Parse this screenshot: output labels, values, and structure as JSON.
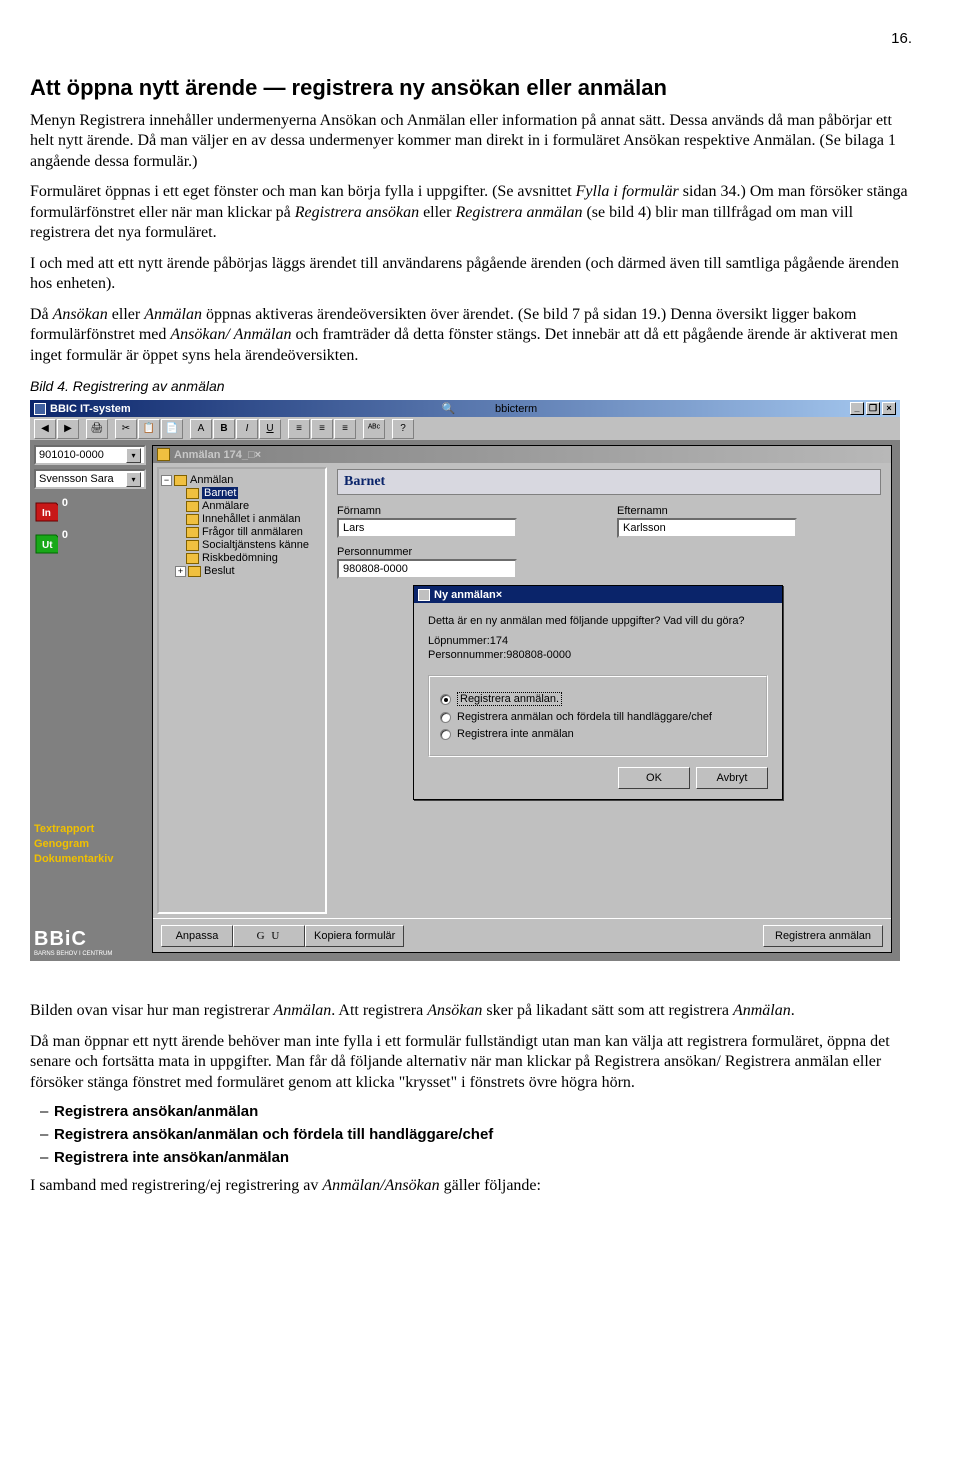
{
  "page_number": "16.",
  "heading": "Att öppna nytt ärende — registrera ny ansökan eller anmälan",
  "para1": "Menyn Registrera innehåller undermenyerna Ansökan och Anmälan eller information på annat sätt. Dessa används då man påbörjar ett helt nytt ärende. Då man väljer en av dessa undermenyer kommer man direkt in i formuläret Ansökan respektive Anmälan. (Se bilaga 1 angående dessa formulär.)",
  "para2a": "Formuläret öppnas i ett eget fönster och man kan börja fylla i uppgifter. (Se avsnittet ",
  "para2b": "Fylla i formulär",
  "para2c": " sidan 34.) Om man försöker stänga formulärfönstret eller när man klickar på ",
  "para2d": "Registrera ansökan",
  "para2e": " eller ",
  "para2f": "Registrera anmälan",
  "para2g": " (se bild 4) blir man tillfrågad om man vill registrera det nya formuläret.",
  "para3": "I och med att ett nytt ärende påbörjas läggs ärendet till användarens pågående ärenden (och därmed även till samtliga pågående ärenden hos enheten).",
  "para4a": "Då ",
  "para4b": "Ansökan",
  "para4c": " eller ",
  "para4d": "Anmälan",
  "para4e": " öppnas aktiveras ärendeöversikten över ärendet. (Se bild 7 på sidan 19.) Denna översikt ligger bakom formulärfönstret med ",
  "para4f": "Ansökan/ Anmälan",
  "para4g": " och framträder då detta fönster stängs. Det innebär att då ett pågående ärende är aktiverat men inget formulär är öppet syns hela ärendeöversikten.",
  "caption": "Bild 4.  Registrering av anmälan",
  "shot": {
    "main_title": "BBIC IT-system",
    "term": "bbicterm",
    "search_icon": "🔍",
    "toolbar": [
      "◀",
      "▶",
      "|",
      "🖨",
      "|",
      "✂",
      "📋",
      "📄",
      "|",
      "A",
      "B",
      "I",
      "U",
      "|",
      "≡",
      "≡",
      "≡",
      "|",
      "ᴬᴮᶜ",
      "|",
      "?"
    ],
    "combo1": "901010-0000",
    "combo2": "Svensson Sara",
    "in_count": "0",
    "out_count": "0",
    "links": [
      "Textrapport",
      "Genogram",
      "Dokumentarkiv"
    ],
    "logo": "BBiC",
    "logo_sub": "BARNS BEHOV I CENTRUM",
    "child_title": "Anmälan 174",
    "tree": {
      "root": "Anmälan",
      "items": [
        "Barnet",
        "Anmälare",
        "Innehållet i anmälan",
        "Frågor till anmälaren",
        "Socialtjänstens känne",
        "Riskbedömning",
        "Beslut"
      ]
    },
    "form_header": "Barnet",
    "field_fn_label": "Förnamn",
    "field_fn_value": "Lars",
    "field_ln_label": "Efternamn",
    "field_ln_value": "Karlsson",
    "field_pn_label": "Personnummer",
    "field_pn_value": "980808-0000",
    "dialog": {
      "title": "Ny anmälan",
      "question": "Detta är en ny anmälan med följande uppgifter? Vad vill du göra?",
      "info1": "Löpnummer:174",
      "info2": "Personnummer:980808-0000",
      "opts": [
        "Registrera anmälan.",
        "Registrera anmälan och fördela till handläggare/chef",
        "Registrera inte anmälan"
      ],
      "ok": "OK",
      "cancel": "Avbryt"
    },
    "bottom": {
      "anpassa": "Anpassa",
      "gu": "G U",
      "kopiera": "Kopiera formulär",
      "registrera": "Registrera anmälan"
    }
  },
  "after1a": "Bilden ovan visar hur man registrerar ",
  "after1b": "Anmälan",
  "after1c": ". Att registrera ",
  "after1d": "Ansökan",
  "after1e": " sker på likadant sätt som att registrera ",
  "after1f": "Anmälan",
  "after1g": ".",
  "after2": "Då man öppnar ett nytt ärende behöver man inte fylla i ett formulär fullständigt utan man kan välja att registrera formuläret, öppna det senare och fortsätta mata in uppgifter. Man får då följande alternativ när man klickar på Registrera ansökan/ Registrera anmälan eller försöker stänga fönstret med formuläret genom att klicka \"krysset\" i fönstrets övre högra hörn.",
  "bullets": [
    "Registrera ansökan/anmälan",
    "Registrera ansökan/anmälan och fördela till handläggare/chef",
    "Registrera inte ansökan/anmälan"
  ],
  "after3a": "I samband med registrering/ej registrering av ",
  "after3b": "Anmälan/Ansökan",
  "after3c": " gäller följande:"
}
